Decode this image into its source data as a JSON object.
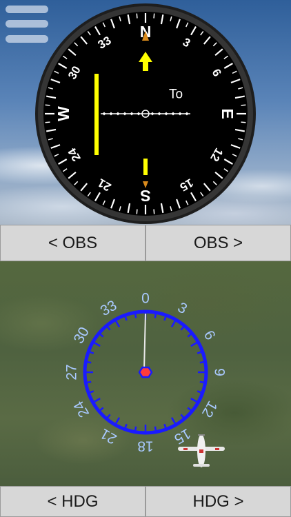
{
  "obs_instrument": {
    "cardinal_labels": [
      "N",
      "E",
      "S",
      "W"
    ],
    "heading_labels": [
      "3",
      "6",
      "12",
      "15",
      "21",
      "24",
      "30",
      "33"
    ],
    "to_from_label": "To",
    "colors": {
      "face": "#000000",
      "bezel": "#2a2a2a",
      "needle": "#ffff00",
      "marker": "#d98a1c"
    }
  },
  "obs_buttons": {
    "left_label": "< OBS",
    "right_label": "OBS >"
  },
  "heading_indicator": {
    "labels": [
      "0",
      "3",
      "6",
      "9",
      "12",
      "15",
      "18",
      "21",
      "24",
      "27",
      "30",
      "33"
    ],
    "colors": {
      "ring": "#1a1aff",
      "labels": "#a9c9ff",
      "center": "#1a1aff"
    }
  },
  "hdg_buttons": {
    "left_label": "< HDG",
    "right_label": "HDG >"
  },
  "icons": {
    "menu": "hamburger-menu-icon",
    "aircraft": "airplane-icon"
  }
}
